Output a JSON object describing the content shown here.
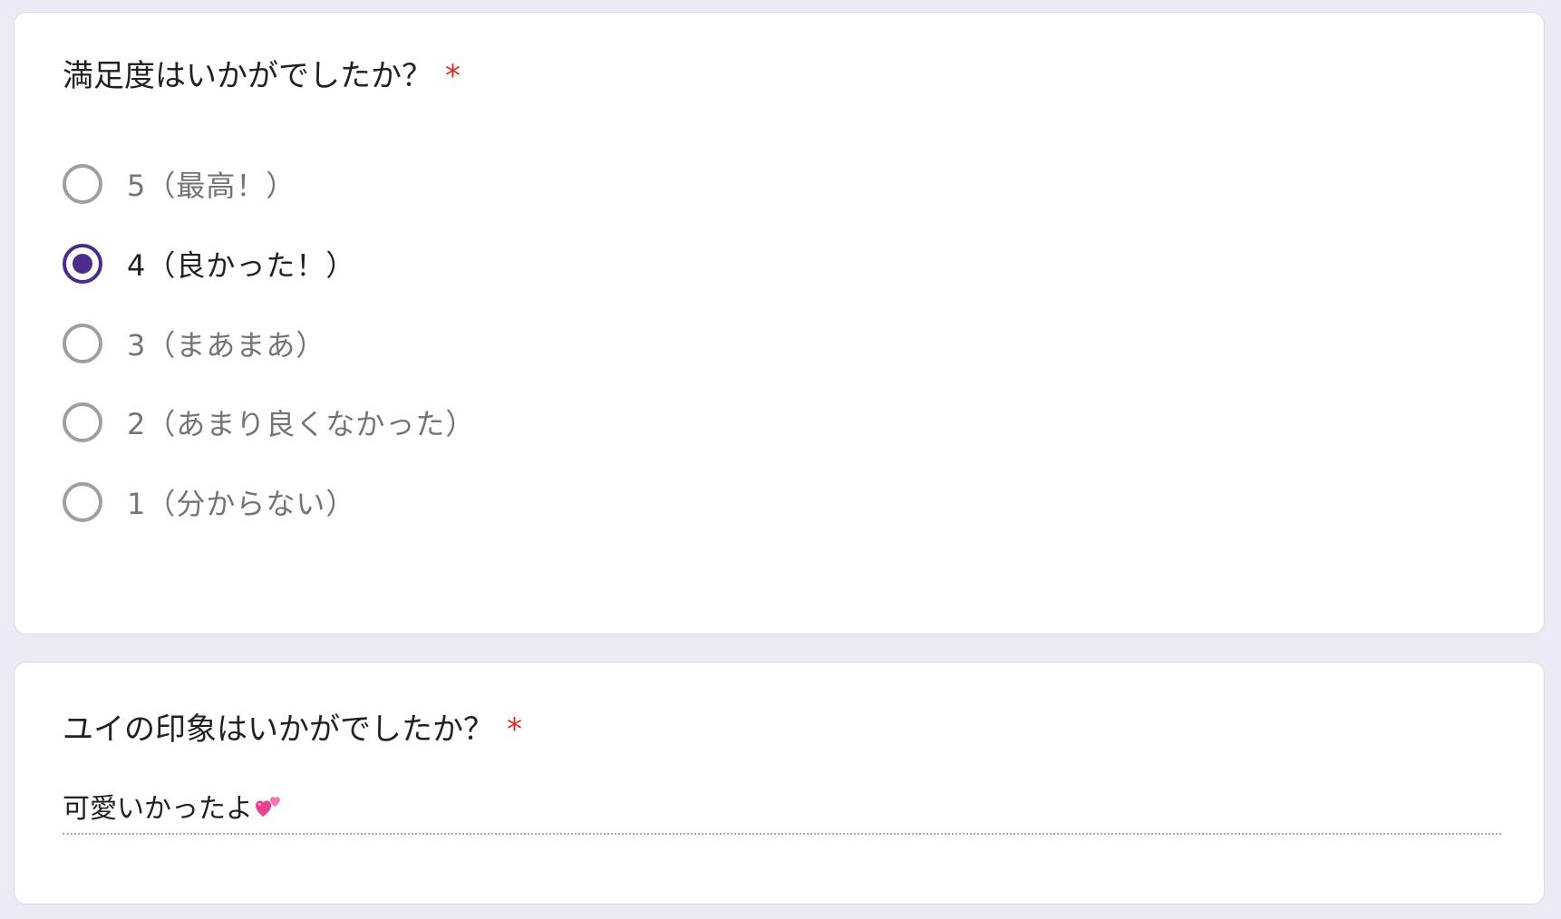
{
  "satisfaction_question": {
    "title": "満足度はいかがでしたか？",
    "required_mark": "*",
    "options": [
      {
        "label": "5（最高！）",
        "selected": false
      },
      {
        "label": "4（良かった！）",
        "selected": true
      },
      {
        "label": "3（まあまあ）",
        "selected": false
      },
      {
        "label": "2（あまり良くなかった）",
        "selected": false
      },
      {
        "label": "1（分からない）",
        "selected": false
      }
    ]
  },
  "impression_question": {
    "title": "ユイの印象はいかがでしたか？",
    "required_mark": "*",
    "answer": "可愛いかったよ",
    "answer_emoji_icon": "two-hearts-icon"
  },
  "colors": {
    "background": "#ede9f5",
    "accent": "#4a2c8a",
    "required": "#d93025",
    "unselected_radio": "#9aa0a6"
  }
}
